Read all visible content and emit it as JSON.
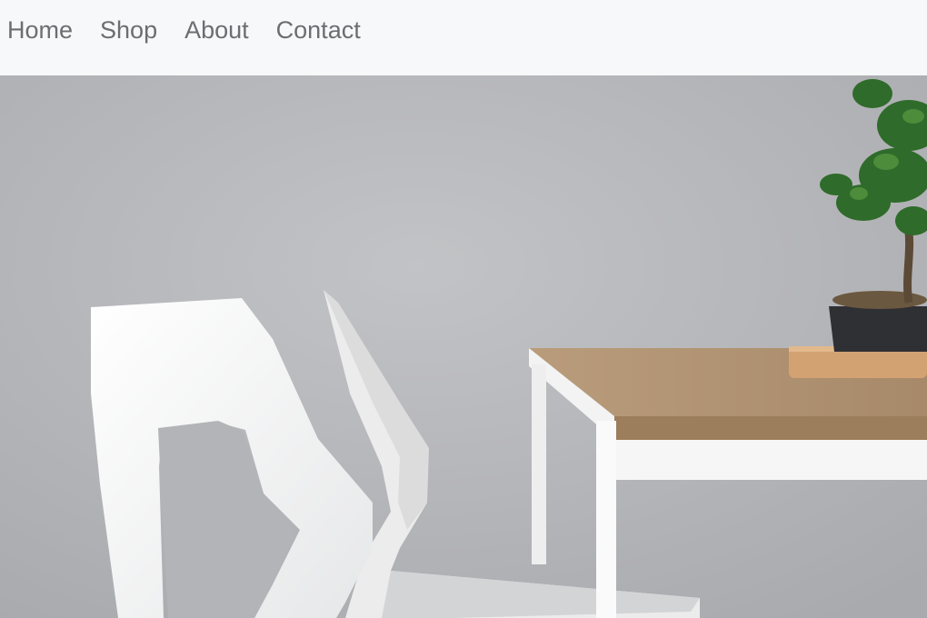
{
  "nav": {
    "items": [
      {
        "label": "Home"
      },
      {
        "label": "Shop"
      },
      {
        "label": "About"
      },
      {
        "label": "Contact"
      }
    ]
  },
  "hero": {
    "image_subject": "white-chairs-wooden-table-bonsai"
  },
  "colors": {
    "nav_background": "#f7f8fa",
    "nav_text": "#6b6e72",
    "wall": "#b9babd"
  }
}
